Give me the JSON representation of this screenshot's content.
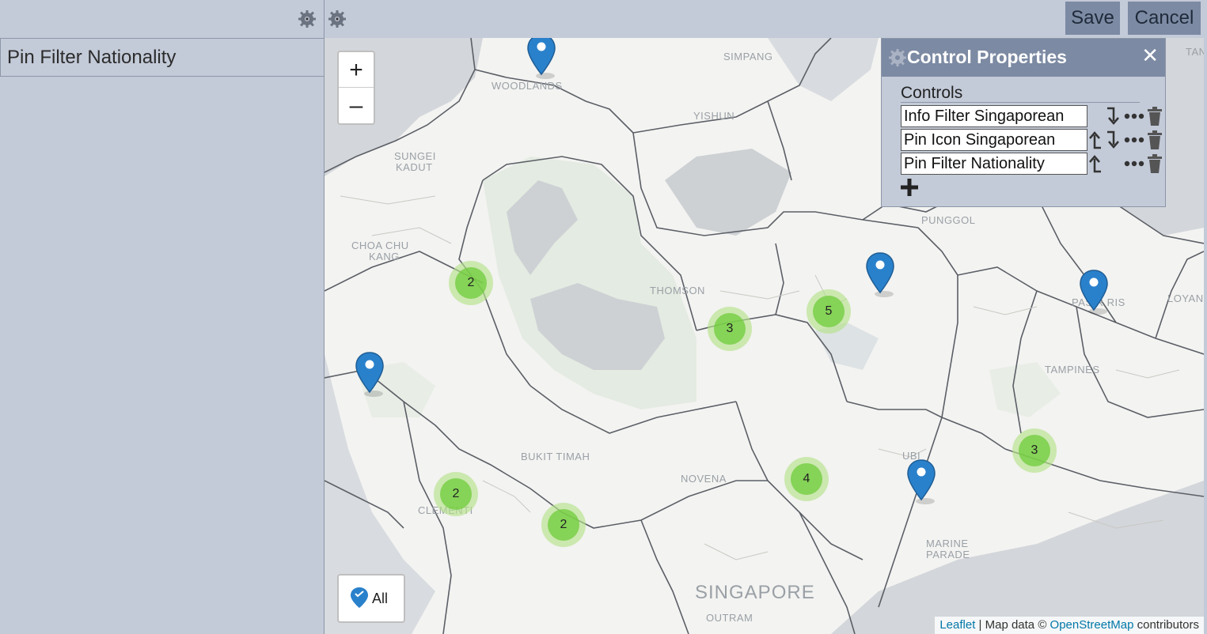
{
  "toolbar": {
    "save_label": "Save",
    "cancel_label": "Cancel"
  },
  "left_panel": {
    "items": [
      {
        "label": "Pin Filter Nationality"
      }
    ]
  },
  "map": {
    "zoom_in": "+",
    "zoom_out": "–",
    "all_label": "All",
    "attribution": {
      "leaflet": "Leaflet",
      "sep": " | Map data © ",
      "osm": "OpenStreetMap",
      "suffix": " contributors"
    },
    "place_labels": [
      "SIMPANG",
      "WOODLANDS",
      "YISHUN",
      "SUNGEI",
      "KADUT",
      "CHOA CHU",
      "KANG",
      "THOMSON",
      "PUNGGOL",
      "PASIR RIS",
      "LOYANG",
      "TAMPINES",
      "BUKIT TIMAH",
      "NOVENA",
      "UBI",
      "MARINE",
      "PARADE",
      "CLEMENTI",
      "SINGAPORE",
      "OUTRAM",
      "TAN"
    ],
    "clusters": [
      {
        "count": "2"
      },
      {
        "count": "3"
      },
      {
        "count": "5"
      },
      {
        "count": "2"
      },
      {
        "count": "2"
      },
      {
        "count": "4"
      },
      {
        "count": "3"
      }
    ],
    "colors": {
      "cluster_outer": "#b5e28c",
      "cluster_inner": "#6ecc39",
      "pin": "#2a81cb",
      "water": "#d3d6da",
      "road": "#5b5f66"
    }
  },
  "dialog": {
    "title": "Control Properties",
    "close_icon": "close-icon",
    "controls_label": "Controls",
    "controls": [
      {
        "name": "Info Filter Singaporean"
      },
      {
        "name": "Pin Icon Singaporean"
      },
      {
        "name": "Pin Filter Nationality"
      }
    ]
  }
}
